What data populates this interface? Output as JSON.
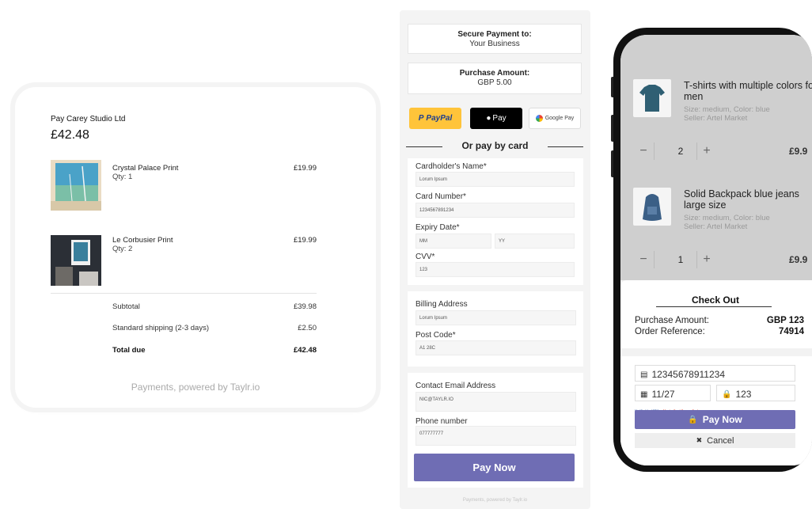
{
  "summary": {
    "pay_to": "Pay Carey Studio Ltd",
    "total": "£42.48",
    "items": [
      {
        "name": "Crystal Palace Print",
        "qty": "Qty: 1",
        "price": "£19.99"
      },
      {
        "name": "Le Corbusier Print",
        "qty": "Qty: 2",
        "price": "£19.99"
      }
    ],
    "subtotal_label": "Subtotal",
    "subtotal_value": "£39.98",
    "shipping_label": "Standard shipping (2-3 days)",
    "shipping_value": "£2.50",
    "total_label": "Total due",
    "total_value": "£42.48",
    "powered": "Payments, powered by Taylr.io"
  },
  "form": {
    "secure_title": "Secure Payment to:",
    "secure_value": "Your Business",
    "amount_title": "Purchase Amount:",
    "amount_value": "GBP 5.00",
    "paypal_label": "PayPal",
    "applepay_label": "Pay",
    "gpay_label": "Google Pay",
    "or_text": "Or pay by card",
    "card": {
      "name_label": "Cardholder's Name*",
      "name_value": "Lorum Ipsum",
      "number_label": "Card Number*",
      "number_value": "1234567891234",
      "expiry_label": "Expiry Date*",
      "mm": "MM",
      "yy": "YY",
      "cvv_label": "CVV*",
      "cvv_value": "123"
    },
    "billing": {
      "address_label": "Billing Address",
      "address_value": "Lorum Ipsum",
      "post_label": "Post Code*",
      "post_value": "A1 28C"
    },
    "contact": {
      "email_label": "Contact Email Address",
      "email_value": "NIC@TAYLR.IO",
      "phone_label": "Phone number",
      "phone_value": "077777777"
    },
    "pay_now": "Pay Now",
    "powered": "Payments, powered by Taylr.io"
  },
  "phone": {
    "products": [
      {
        "title": "T-shirts with multiple colors for men",
        "meta1": "Size: medium, Color: blue",
        "meta2": "Seller: Artel Market",
        "qty": "2",
        "price": "£9.9"
      },
      {
        "title": "Solid Backpack blue jeans large size",
        "meta1": "Size: medium, Color: blue",
        "meta2": "Seller: Artel Market",
        "qty": "1",
        "price": "£9.9"
      }
    ],
    "qty_minus": "−",
    "qty_plus": "+",
    "checkout_title": "Check Out",
    "amount_label": "Purchase Amount:",
    "amount_value": "GBP 123",
    "ref_label": "Order Reference:",
    "ref_value": "74914",
    "card_number": "12345678911234",
    "expiry": "11/27",
    "cvv": "123",
    "logo_visa": "Verified by VISA",
    "logo_mc": "MasterCard SecureCode",
    "pay_now": "Pay Now",
    "cancel": "Cancel"
  }
}
